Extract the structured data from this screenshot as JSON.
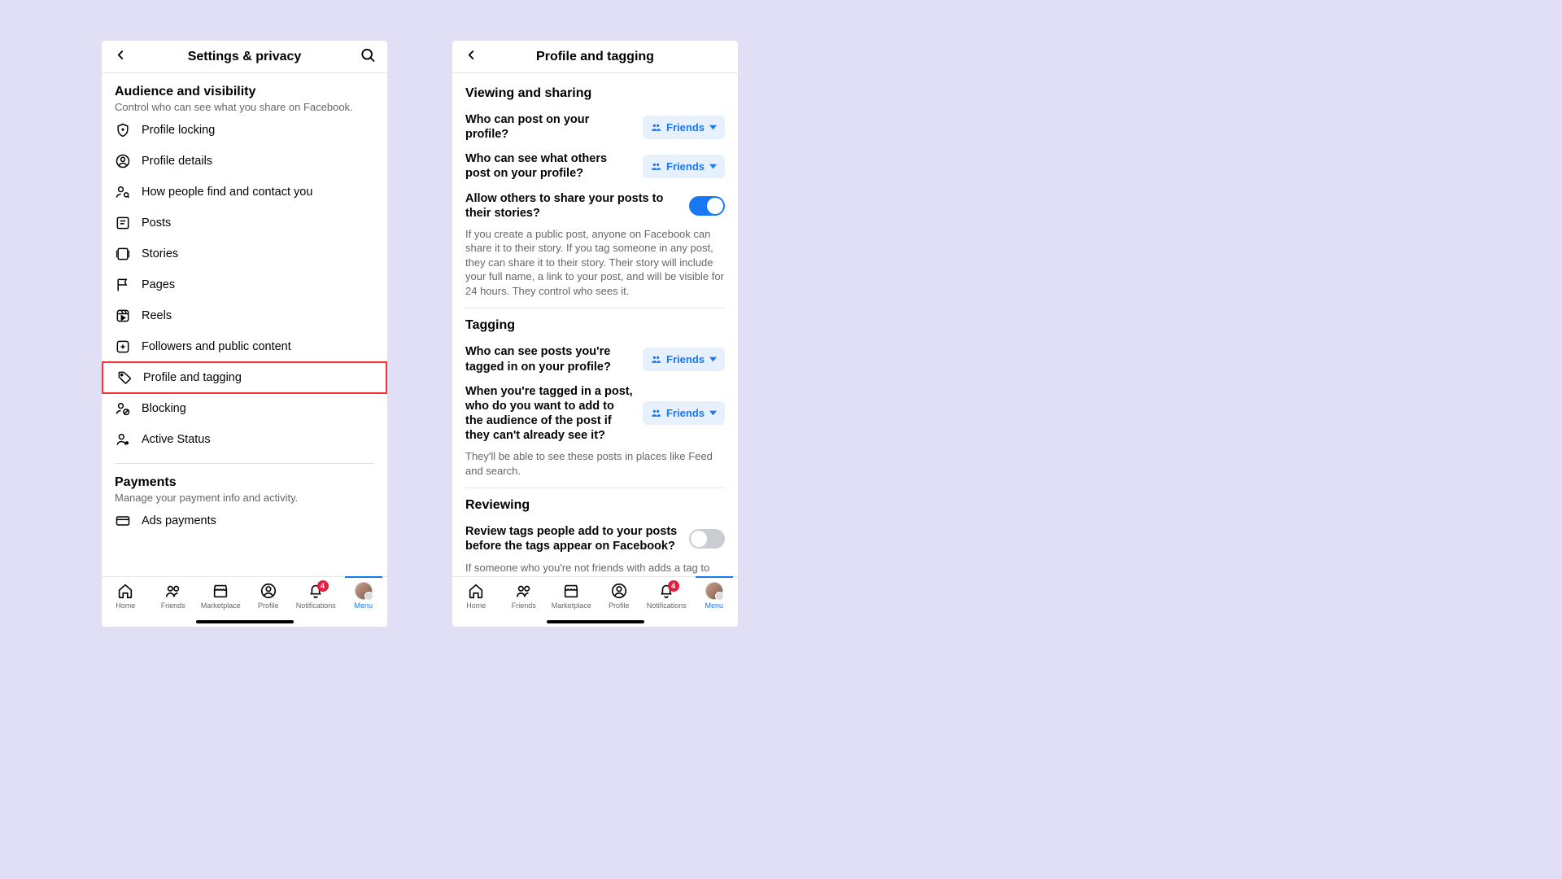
{
  "screen1": {
    "title": "Settings & privacy",
    "sectionA": {
      "head": "Audience and visibility",
      "sub": "Control who can see what you share on Facebook."
    },
    "items": [
      "Profile locking",
      "Profile details",
      "How people find and contact you",
      "Posts",
      "Stories",
      "Pages",
      "Reels",
      "Followers and public content",
      "Profile and tagging",
      "Blocking",
      "Active Status"
    ],
    "sectionB": {
      "head": "Payments",
      "sub": "Manage your payment info and activity."
    },
    "itemsB": [
      "Ads payments"
    ]
  },
  "screen2": {
    "title": "Profile and tagging",
    "viewing": {
      "head": "Viewing and sharing",
      "q1": "Who can post on your profile?",
      "q2": "Who can see what others post on your profile?",
      "q3": "Allow others to share your posts to their stories?",
      "desc3": "If you create a public post, anyone on Facebook can share it to their story. If you tag someone in any post, they can share it to their story. Their story will include your full name, a link to your post, and will be visible for 24 hours. They control who sees it."
    },
    "tagging": {
      "head": "Tagging",
      "q1": "Who can see posts you're tagged in on your profile?",
      "q2": "When you're tagged in a post, who do you want to add to the audience of the post if they can't already see it?",
      "desc2": "They'll be able to see these posts in places like Feed and search."
    },
    "reviewing": {
      "head": "Reviewing",
      "q1": "Review tags people add to your posts before the tags appear on Facebook?",
      "desc1": "If someone who you're not friends with adds a tag to"
    },
    "friends_label": "Friends"
  },
  "tabs": {
    "home": "Home",
    "friends": "Friends",
    "market": "Marketplace",
    "profile": "Profile",
    "notif": "Notifications",
    "menu": "Menu",
    "badge": "4"
  }
}
